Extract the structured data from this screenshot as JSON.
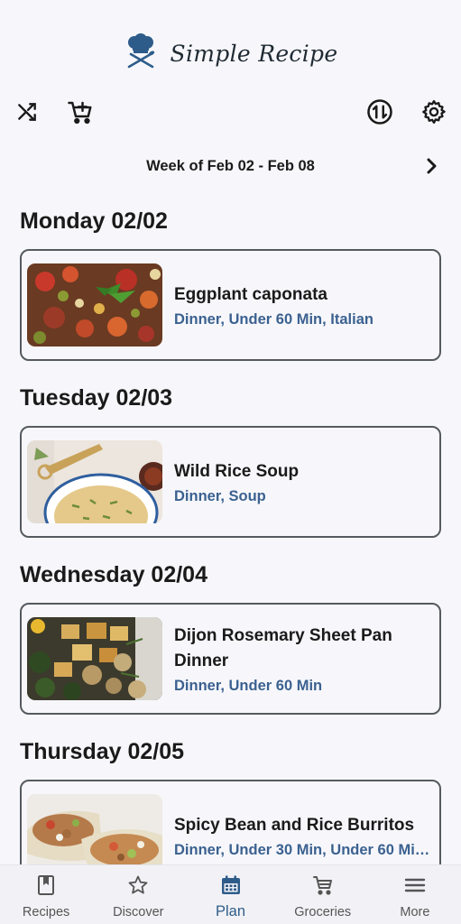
{
  "app": {
    "brand_name": "Simple Recipe",
    "brand_logo_icon": "chef-hat-utensils-icon",
    "accent_color": "#2e5c8a",
    "tag_color": "#3b6190"
  },
  "toolbar": {
    "shuffle_icon": "shuffle-icon",
    "add_to_cart_icon": "add-shopping-cart-icon",
    "sync_icon": "sync-arrows-icon",
    "settings_icon": "gear-icon"
  },
  "week": {
    "label": "Week of Feb 02 - Feb 08",
    "next_icon": "chevron-right-icon"
  },
  "days": [
    {
      "title": "Monday 02/02",
      "recipe": {
        "name": "Eggplant caponata",
        "tags": "Dinner, Under 60 Min, Italian"
      }
    },
    {
      "title": "Tuesday 02/03",
      "recipe": {
        "name": "Wild Rice Soup",
        "tags": "Dinner, Soup"
      }
    },
    {
      "title": "Wednesday 02/04",
      "recipe": {
        "name": "Dijon Rosemary Sheet Pan Dinner",
        "tags": "Dinner, Under 60 Min"
      }
    },
    {
      "title": "Thursday 02/05",
      "recipe": {
        "name": "Spicy Bean and Rice Burritos",
        "tags": "Dinner, Under 30 Min, Under 60 Mi…"
      }
    }
  ],
  "bottom_nav": {
    "items": [
      {
        "label": "Recipes",
        "icon": "book-icon"
      },
      {
        "label": "Discover",
        "icon": "star-icon"
      },
      {
        "label": "Plan",
        "icon": "calendar-icon",
        "active": true
      },
      {
        "label": "Groceries",
        "icon": "cart-icon"
      },
      {
        "label": "More",
        "icon": "menu-icon"
      }
    ]
  }
}
